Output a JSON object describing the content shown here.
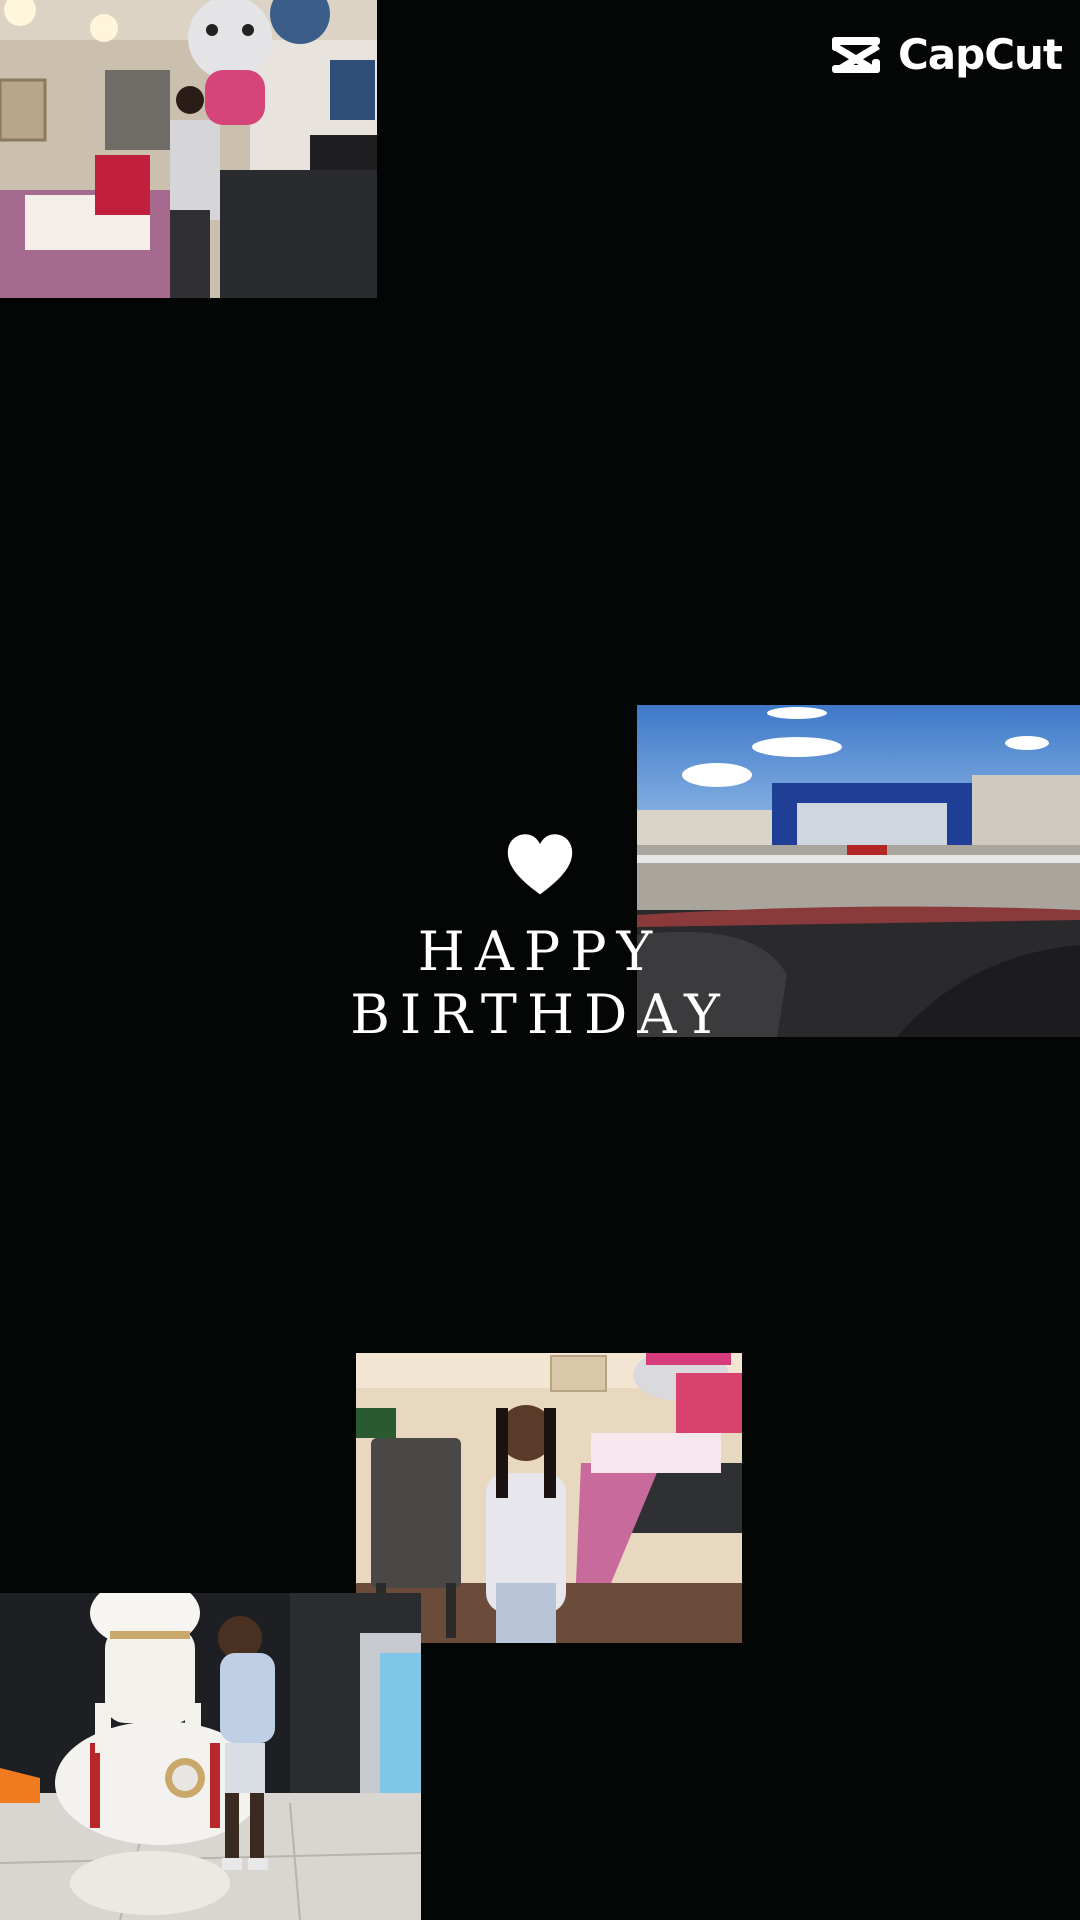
{
  "watermark": {
    "brand": "CapCut",
    "icon": "capcut-logo-icon"
  },
  "title": {
    "line1": "HAPPY",
    "line2": "BIRTHDAY",
    "icon": "heart-icon",
    "color": "#ffffff"
  },
  "background_color": "#030605",
  "photos": [
    {
      "name": "photo-living-room",
      "description_icon": "photo"
    },
    {
      "name": "photo-parking-lot",
      "description_icon": "photo"
    },
    {
      "name": "photo-dining-room",
      "description_icon": "photo"
    },
    {
      "name": "photo-astronaut",
      "description_icon": "photo"
    }
  ]
}
